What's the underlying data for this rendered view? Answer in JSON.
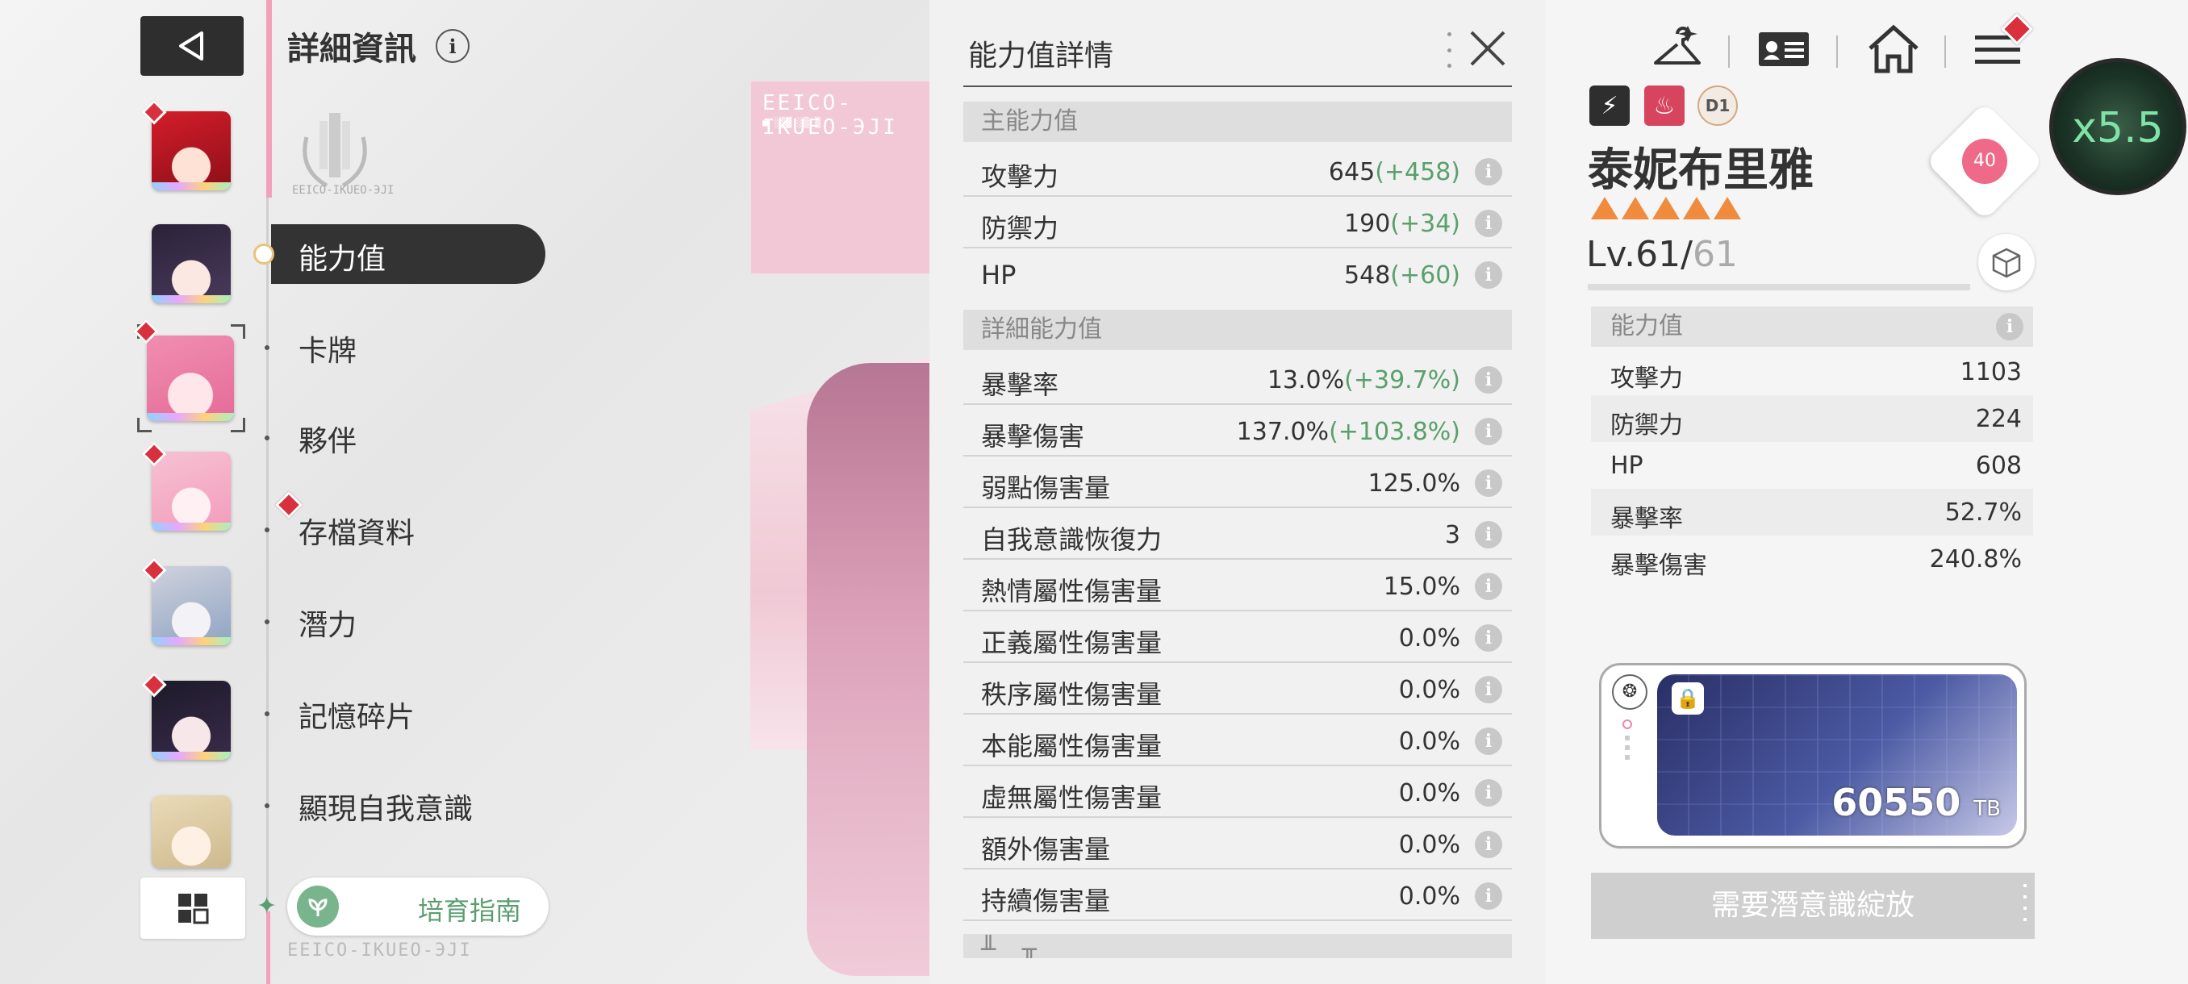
{
  "header": {
    "title": "詳細資訊",
    "info": "i"
  },
  "emblem_code": "EEICO-IKUEO-ЭJI",
  "art": {
    "code": "EEICO-IKUEO-ЭJI",
    "subcode": "■ ░▒▓ ░▒ ▒"
  },
  "menu": {
    "active": "能力值",
    "items": [
      "卡牌",
      "夥伴",
      "存檔資料",
      "潛力",
      "記憶碎片",
      "顯現自我意識"
    ]
  },
  "guide_label": "培育指南",
  "bottom_code": "EEICO-IKUEO-ЭJI",
  "stats_panel": {
    "title": "能力值詳情",
    "main_header": "主能力值",
    "main_stats": [
      {
        "name": "攻擊力",
        "base": "645",
        "bonus": "(+458)"
      },
      {
        "name": "防禦力",
        "base": "190",
        "bonus": "(+34)"
      },
      {
        "name": "HP",
        "base": "548",
        "bonus": "(+60)"
      }
    ],
    "detail_header": "詳細能力值",
    "detail_stats": [
      {
        "name": "暴擊率",
        "base": "13.0%",
        "bonus": "(+39.7%)"
      },
      {
        "name": "暴擊傷害",
        "base": "137.0%",
        "bonus": "(+103.8%)"
      },
      {
        "name": "弱點傷害量",
        "base": "125.0%",
        "bonus": ""
      },
      {
        "name": "自我意識恢復力",
        "base": "3",
        "bonus": ""
      },
      {
        "name": "熱情屬性傷害量",
        "base": "15.0%",
        "bonus": ""
      },
      {
        "name": "正義屬性傷害量",
        "base": "0.0%",
        "bonus": ""
      },
      {
        "name": "秩序屬性傷害量",
        "base": "0.0%",
        "bonus": ""
      },
      {
        "name": "本能屬性傷害量",
        "base": "0.0%",
        "bonus": ""
      },
      {
        "name": "虛無屬性傷害量",
        "base": "0.0%",
        "bonus": ""
      },
      {
        "name": "額外傷害量",
        "base": "0.0%",
        "bonus": ""
      },
      {
        "name": "持續傷害量",
        "base": "0.0%",
        "bonus": ""
      }
    ],
    "next_header_partial": "╨▁ ╥▁ ▁"
  },
  "character": {
    "element_tags": [
      "⚡",
      "♨",
      "D1"
    ],
    "name": "泰妮布里雅",
    "stars": 5,
    "affinity": "40",
    "level_prefix": "Lv.61/",
    "level_max": "61",
    "stats_header": "能力值",
    "stats": [
      {
        "name": "攻擊力",
        "value": "1103"
      },
      {
        "name": "防禦力",
        "value": "224"
      },
      {
        "name": "HP",
        "value": "608"
      },
      {
        "name": "暴擊率",
        "value": "52.7%"
      },
      {
        "name": "暴擊傷害",
        "value": "240.8%"
      }
    ],
    "card_value": "60550",
    "card_unit": "TB",
    "awaken_button": "需要潛意識綻放"
  },
  "speed": "x5.5",
  "colors": {
    "bonus_green": "#5aa06a",
    "alert_red": "#d9303d",
    "star_orange": "#f08a3c",
    "heart_pink": "#ef6a88",
    "menu_active_bg": "#333333"
  }
}
